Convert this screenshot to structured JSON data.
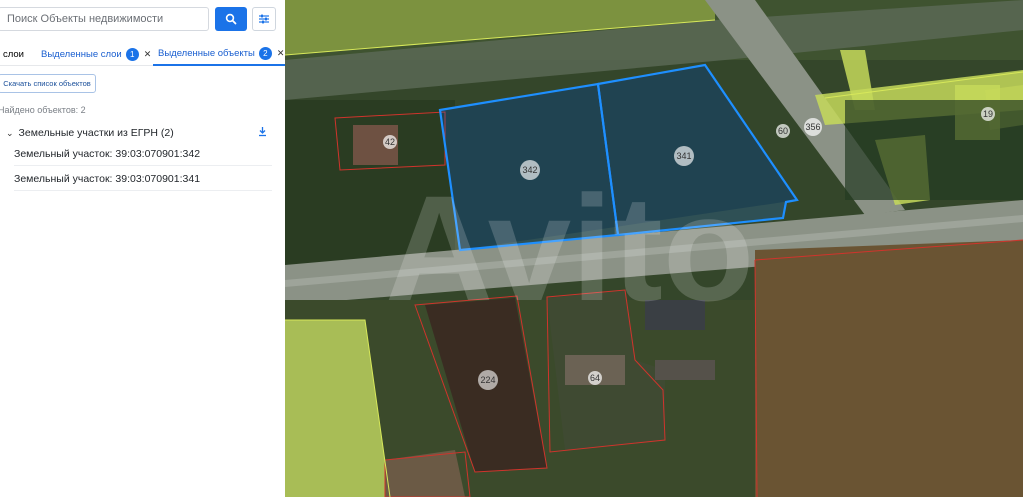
{
  "search": {
    "placeholder": "Поиск Объекты недвижимости"
  },
  "tabs": [
    {
      "label": "слои"
    },
    {
      "label": "Выделенные слои",
      "badge": "1"
    },
    {
      "label": "Выделенные объекты",
      "badge": "2"
    }
  ],
  "download_list_label": "Скачать список объектов",
  "found_count_text": "Найдено объектов: 2",
  "group": {
    "label": "Земельные участки из ЕГРН (2)"
  },
  "items": [
    {
      "label": "Земельный участок: 39:03:070901:342"
    },
    {
      "label": "Земельный участок: 39:03:070901:341"
    }
  ],
  "map_labels": {
    "p42": "42",
    "p342": "342",
    "p341": "341",
    "p60": "60",
    "p356": "356",
    "p19": "19",
    "p224": "224",
    "p64": "64"
  },
  "watermark": "Avito",
  "colors": {
    "accent": "#1b73e8",
    "selection": "#1e8fff",
    "parcel_outline": "#d0342c",
    "zone": "#d7e85a"
  }
}
